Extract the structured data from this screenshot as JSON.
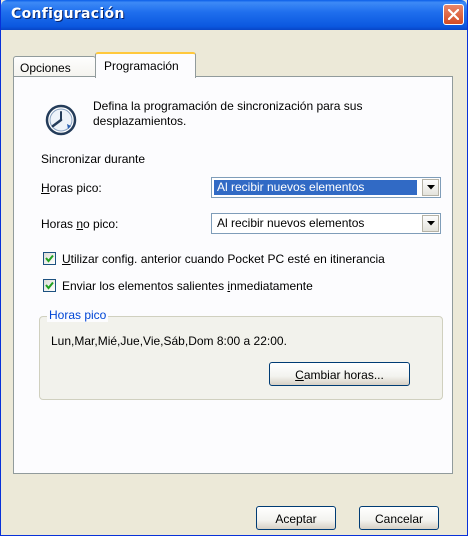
{
  "window": {
    "title": "Configuración"
  },
  "tabs": [
    {
      "label": "Opciones",
      "active": false
    },
    {
      "label": "Programación",
      "active": true
    }
  ],
  "intro": {
    "icon": "clock-icon",
    "line1": "Defina la programación de sincronización para sus",
    "line2": "desplazamientos."
  },
  "sync_label": "Sincronizar durante",
  "peak": {
    "label_prefix": "",
    "label_hot": "H",
    "label_rest": "oras pico:",
    "value": "Al recibir nuevos elementos"
  },
  "offpeak": {
    "label_prefix": "Horas ",
    "label_hot": "n",
    "label_rest": "o pico:",
    "value": "Al recibir nuevos elementos"
  },
  "checks": [
    {
      "hot": "U",
      "rest": "tilizar config. anterior cuando Pocket PC esté en itinerancia",
      "checked": true
    },
    {
      "pre": "Enviar los elementos salientes ",
      "hot": "i",
      "rest": "nmediatamente",
      "checked": true
    }
  ],
  "peak_group": {
    "legend": "Horas pico",
    "schedule": "Lun,Mar,Mié,Jue,Vie,Sáb,Dom 8:00 a 22:00.",
    "change_hot": "C",
    "change_rest": "ambiar horas..."
  },
  "footer": {
    "accept": "Aceptar",
    "cancel": "Cancelar"
  },
  "colors": {
    "titlebar": "#0b58df",
    "accent": "#316ac5",
    "legend": "#0046d5",
    "close": "#d34b24"
  }
}
